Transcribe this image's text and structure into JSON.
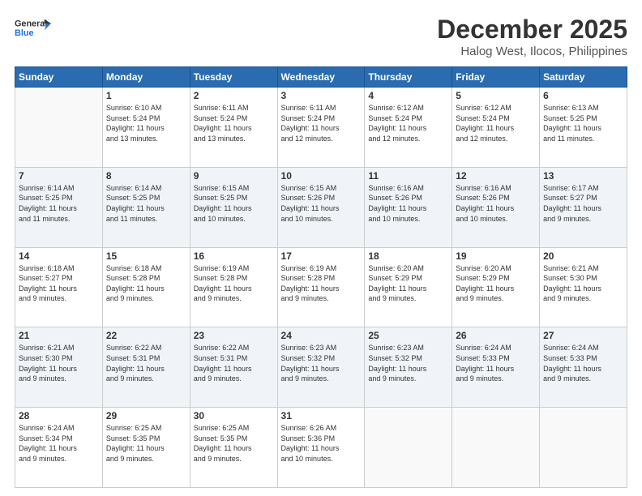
{
  "logo": {
    "line1": "General",
    "line2": "Blue"
  },
  "title": "December 2025",
  "subtitle": "Halog West, Ilocos, Philippines",
  "weekdays": [
    "Sunday",
    "Monday",
    "Tuesday",
    "Wednesday",
    "Thursday",
    "Friday",
    "Saturday"
  ],
  "weeks": [
    [
      {
        "day": "",
        "info": ""
      },
      {
        "day": "1",
        "info": "Sunrise: 6:10 AM\nSunset: 5:24 PM\nDaylight: 11 hours\nand 13 minutes."
      },
      {
        "day": "2",
        "info": "Sunrise: 6:11 AM\nSunset: 5:24 PM\nDaylight: 11 hours\nand 13 minutes."
      },
      {
        "day": "3",
        "info": "Sunrise: 6:11 AM\nSunset: 5:24 PM\nDaylight: 11 hours\nand 12 minutes."
      },
      {
        "day": "4",
        "info": "Sunrise: 6:12 AM\nSunset: 5:24 PM\nDaylight: 11 hours\nand 12 minutes."
      },
      {
        "day": "5",
        "info": "Sunrise: 6:12 AM\nSunset: 5:24 PM\nDaylight: 11 hours\nand 12 minutes."
      },
      {
        "day": "6",
        "info": "Sunrise: 6:13 AM\nSunset: 5:25 PM\nDaylight: 11 hours\nand 11 minutes."
      }
    ],
    [
      {
        "day": "7",
        "info": "Sunrise: 6:14 AM\nSunset: 5:25 PM\nDaylight: 11 hours\nand 11 minutes."
      },
      {
        "day": "8",
        "info": "Sunrise: 6:14 AM\nSunset: 5:25 PM\nDaylight: 11 hours\nand 11 minutes."
      },
      {
        "day": "9",
        "info": "Sunrise: 6:15 AM\nSunset: 5:25 PM\nDaylight: 11 hours\nand 10 minutes."
      },
      {
        "day": "10",
        "info": "Sunrise: 6:15 AM\nSunset: 5:26 PM\nDaylight: 11 hours\nand 10 minutes."
      },
      {
        "day": "11",
        "info": "Sunrise: 6:16 AM\nSunset: 5:26 PM\nDaylight: 11 hours\nand 10 minutes."
      },
      {
        "day": "12",
        "info": "Sunrise: 6:16 AM\nSunset: 5:26 PM\nDaylight: 11 hours\nand 10 minutes."
      },
      {
        "day": "13",
        "info": "Sunrise: 6:17 AM\nSunset: 5:27 PM\nDaylight: 11 hours\nand 9 minutes."
      }
    ],
    [
      {
        "day": "14",
        "info": "Sunrise: 6:18 AM\nSunset: 5:27 PM\nDaylight: 11 hours\nand 9 minutes."
      },
      {
        "day": "15",
        "info": "Sunrise: 6:18 AM\nSunset: 5:28 PM\nDaylight: 11 hours\nand 9 minutes."
      },
      {
        "day": "16",
        "info": "Sunrise: 6:19 AM\nSunset: 5:28 PM\nDaylight: 11 hours\nand 9 minutes."
      },
      {
        "day": "17",
        "info": "Sunrise: 6:19 AM\nSunset: 5:28 PM\nDaylight: 11 hours\nand 9 minutes."
      },
      {
        "day": "18",
        "info": "Sunrise: 6:20 AM\nSunset: 5:29 PM\nDaylight: 11 hours\nand 9 minutes."
      },
      {
        "day": "19",
        "info": "Sunrise: 6:20 AM\nSunset: 5:29 PM\nDaylight: 11 hours\nand 9 minutes."
      },
      {
        "day": "20",
        "info": "Sunrise: 6:21 AM\nSunset: 5:30 PM\nDaylight: 11 hours\nand 9 minutes."
      }
    ],
    [
      {
        "day": "21",
        "info": "Sunrise: 6:21 AM\nSunset: 5:30 PM\nDaylight: 11 hours\nand 9 minutes."
      },
      {
        "day": "22",
        "info": "Sunrise: 6:22 AM\nSunset: 5:31 PM\nDaylight: 11 hours\nand 9 minutes."
      },
      {
        "day": "23",
        "info": "Sunrise: 6:22 AM\nSunset: 5:31 PM\nDaylight: 11 hours\nand 9 minutes."
      },
      {
        "day": "24",
        "info": "Sunrise: 6:23 AM\nSunset: 5:32 PM\nDaylight: 11 hours\nand 9 minutes."
      },
      {
        "day": "25",
        "info": "Sunrise: 6:23 AM\nSunset: 5:32 PM\nDaylight: 11 hours\nand 9 minutes."
      },
      {
        "day": "26",
        "info": "Sunrise: 6:24 AM\nSunset: 5:33 PM\nDaylight: 11 hours\nand 9 minutes."
      },
      {
        "day": "27",
        "info": "Sunrise: 6:24 AM\nSunset: 5:33 PM\nDaylight: 11 hours\nand 9 minutes."
      }
    ],
    [
      {
        "day": "28",
        "info": "Sunrise: 6:24 AM\nSunset: 5:34 PM\nDaylight: 11 hours\nand 9 minutes."
      },
      {
        "day": "29",
        "info": "Sunrise: 6:25 AM\nSunset: 5:35 PM\nDaylight: 11 hours\nand 9 minutes."
      },
      {
        "day": "30",
        "info": "Sunrise: 6:25 AM\nSunset: 5:35 PM\nDaylight: 11 hours\nand 9 minutes."
      },
      {
        "day": "31",
        "info": "Sunrise: 6:26 AM\nSunset: 5:36 PM\nDaylight: 11 hours\nand 10 minutes."
      },
      {
        "day": "",
        "info": ""
      },
      {
        "day": "",
        "info": ""
      },
      {
        "day": "",
        "info": ""
      }
    ]
  ]
}
